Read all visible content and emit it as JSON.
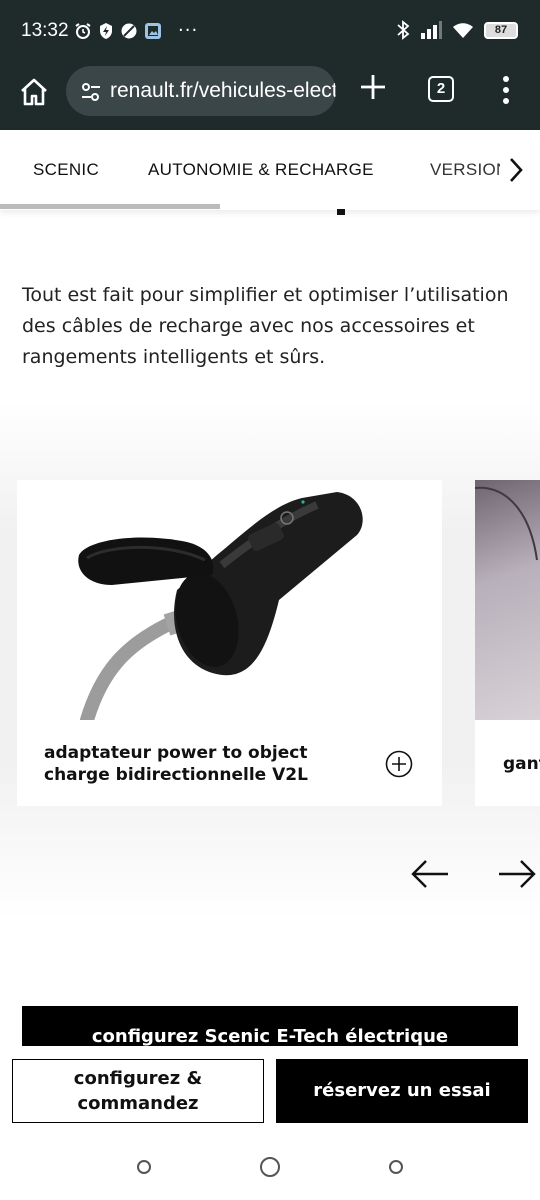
{
  "status_bar": {
    "time": "13:32",
    "dots": "···",
    "battery": "87"
  },
  "browser": {
    "url": "renault.fr/vehicules-electriques/scenic",
    "tab_count": "2"
  },
  "nav_tabs": [
    {
      "label": "SCENIC"
    },
    {
      "label": "AUTONOMIE & RECHARGE"
    },
    {
      "label": "VERSIONS"
    }
  ],
  "intro_text": "Tout est fait pour simplifier et optimiser l’utilisation des câbles de recharge avec nos accessoires et rangements intelligents et sûrs.",
  "carousel": {
    "cards": [
      {
        "title": "adaptateur power to object charge bidirectionnelle V2L"
      },
      {
        "title": "gant"
      }
    ]
  },
  "config_banner": "configurez Scenic E-Tech électrique",
  "bottom_actions": {
    "configure_label": "configurez & commandez",
    "test_drive_label": "réservez un essai"
  },
  "icons": {
    "home": "home-icon",
    "site_settings": "tune-icon",
    "new_tab": "plus-icon",
    "menu": "kebab-icon",
    "next": "chevron-right-icon",
    "expand": "plus-circle-icon",
    "prev_arrow": "arrow-left-icon",
    "next_arrow": "arrow-right-icon"
  },
  "colors": {
    "browser_chrome": "#1f2a2b",
    "url_pill": "#3a4647",
    "brand_black": "#000000"
  }
}
